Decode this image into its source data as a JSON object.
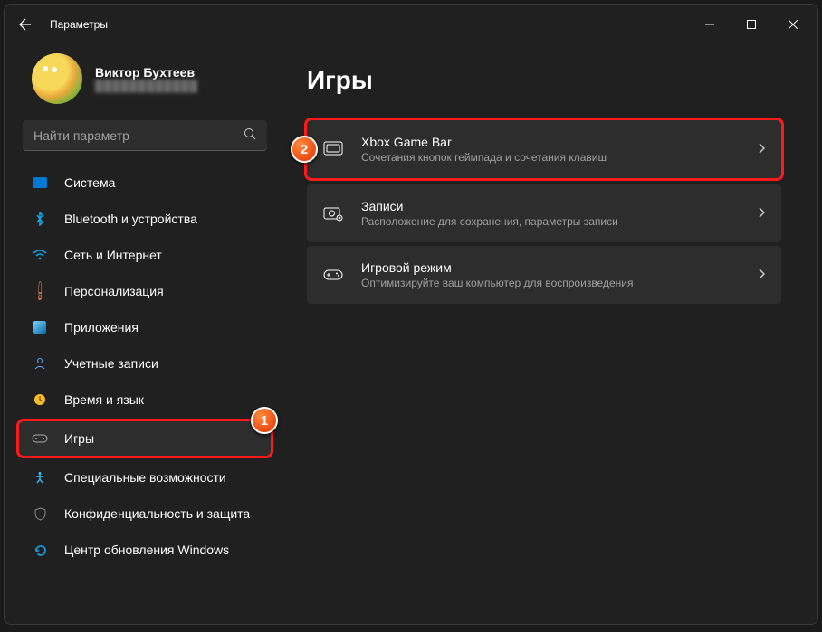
{
  "titlebar": {
    "title": "Параметры"
  },
  "profile": {
    "name": "Виктор Бухтеев",
    "email": "████████████"
  },
  "search": {
    "placeholder": "Найти параметр"
  },
  "nav": [
    {
      "label": "Система"
    },
    {
      "label": "Bluetooth и устройства"
    },
    {
      "label": "Сеть и Интернет"
    },
    {
      "label": "Персонализация"
    },
    {
      "label": "Приложения"
    },
    {
      "label": "Учетные записи"
    },
    {
      "label": "Время и язык"
    },
    {
      "label": "Игры"
    },
    {
      "label": "Специальные возможности"
    },
    {
      "label": "Конфиденциальность и защита"
    },
    {
      "label": "Центр обновления Windows"
    }
  ],
  "page": {
    "title": "Игры"
  },
  "cards": [
    {
      "title": "Xbox Game Bar",
      "sub": "Сочетания кнопок геймпада и сочетания клавиш"
    },
    {
      "title": "Записи",
      "sub": "Расположение для сохранения, параметры записи"
    },
    {
      "title": "Игровой режим",
      "sub": "Оптимизируйте ваш компьютер для воспроизведения"
    }
  ],
  "annotations": {
    "badge1": "1",
    "badge2": "2"
  }
}
